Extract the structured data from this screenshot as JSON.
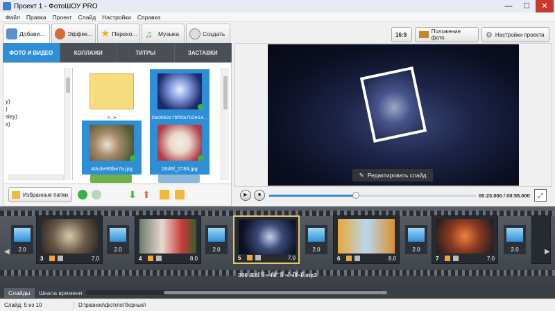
{
  "window": {
    "title": "Проект 1 - ФотоШОУ PRO",
    "min": "—",
    "max": "☐",
    "close": "✕"
  },
  "menu": [
    "Файл",
    "Правка",
    "Проект",
    "Слайд",
    "Настройки",
    "Справка"
  ],
  "main_tabs": [
    {
      "label": "Добави...",
      "icon": "photo-add-icon"
    },
    {
      "label": "Эффек...",
      "icon": "effects-palette-icon"
    },
    {
      "label": "Перехо...",
      "icon": "star-transition-icon"
    },
    {
      "label": "Музыка",
      "icon": "music-note-icon"
    },
    {
      "label": "Создать",
      "icon": "film-reel-icon"
    }
  ],
  "sub_tabs": [
    "ФОТО И ВИДЕО",
    "КОЛЛАЖИ",
    "ТИТРЫ",
    "ЗАСТАВКИ"
  ],
  "tree_items": [
    "у)",
    ")",
    "sley)",
    "х)"
  ],
  "files": [
    {
      "caption": "<..>"
    },
    {
      "caption": "0a0662c7bf5fa702e14..."
    },
    {
      "caption": "4dcde80fbe7a.jpg"
    },
    {
      "caption": "26d6f_2784.jpg"
    }
  ],
  "favorites_button": "Избранные папки",
  "right_toolbar": {
    "aspect": "16:9",
    "photo_position": "Положение фото",
    "project_settings": "Настройки проекта"
  },
  "preview": {
    "edit_slide": "Редактировать слайд"
  },
  "player": {
    "time": "00:23.000 / 00:55.000",
    "progress": 0.42
  },
  "slides": [
    {
      "num": "3",
      "duration": "7.0"
    },
    {
      "num": "4",
      "duration": "8.0"
    },
    {
      "num": "5",
      "duration": "7.0"
    },
    {
      "num": "6",
      "duration": "8.0"
    },
    {
      "num": "7",
      "duration": "7.0"
    }
  ],
  "transitions": [
    "2.0",
    "2.0",
    "2.0",
    "2.0",
    "2.0",
    "2.0"
  ],
  "audio_track": "006 ÆõÎ¨ÎÎ¬¬ÑÎ¨¨ÎÎ ¬Ï¬ÎÎÎ¬ÎÎ.mp3",
  "bottom_tabs": [
    "Слайды",
    "Шкала времени"
  ],
  "status": {
    "slide": "Слайд: 5 из 10",
    "path": "D:\\разное\\фото\\отборные\\"
  }
}
